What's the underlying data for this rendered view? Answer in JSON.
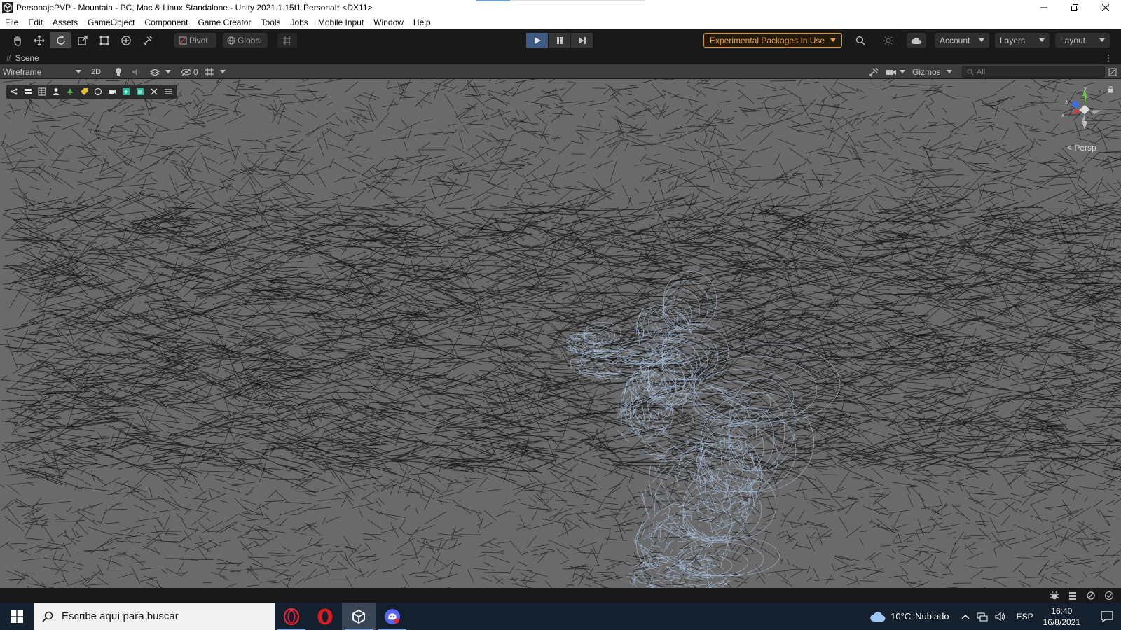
{
  "window": {
    "title": "PersonajePVP - Mountain - PC, Mac & Linux Standalone - Unity 2021.1.15f1 Personal* <DX11>"
  },
  "menu": [
    "File",
    "Edit",
    "Assets",
    "GameObject",
    "Component",
    "Game Creator",
    "Tools",
    "Jobs",
    "Mobile Input",
    "Window",
    "Help"
  ],
  "toolbar": {
    "tools": [
      "hand-icon",
      "move-icon",
      "rotate-icon",
      "scale-icon",
      "rect-icon",
      "transform-icon",
      "custom-tool-icon"
    ],
    "active_tool": "rotate-icon",
    "pivot_label": "Pivot",
    "global_label": "Global",
    "experimental_label": "Experimental Packages In Use",
    "account_label": "Account",
    "layers_label": "Layers",
    "layout_label": "Layout"
  },
  "scene": {
    "tab_label": "Scene",
    "draw_mode": "Wireframe",
    "mode_2d": "2D",
    "hidden_count": "0",
    "gizmos_label": "Gizmos",
    "search_placeholder": "All",
    "persp_label": "< Persp",
    "axis_labels": {
      "x": "x",
      "y": "y",
      "z": "z"
    }
  },
  "taskbar": {
    "search_placeholder": "Escribe aquí para buscar",
    "weather_temp": "10°C",
    "weather_text": "Nublado",
    "language": "ESP",
    "time": "16:40",
    "date": "16/8/2021"
  },
  "colors": {
    "accent_play": "#3d5a84",
    "warning": "#e8a33c",
    "wireframe_character": "#a8c0dd"
  }
}
